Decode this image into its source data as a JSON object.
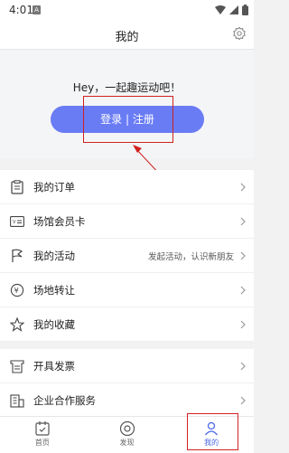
{
  "status_bar": {
    "time": "4:01",
    "sim_letter": "A"
  },
  "header": {
    "title": "我的"
  },
  "hero": {
    "greeting": "Hey，一起趣运动吧！",
    "login_label": "登录 | 注册"
  },
  "menu_group_1": [
    {
      "label": "我的订单",
      "sub": "",
      "icon": "clipboard-icon"
    },
    {
      "label": "场馆会员卡",
      "sub": "",
      "icon": "vip-card-icon"
    },
    {
      "label": "我的活动",
      "sub": "发起活动，认识新朋友",
      "icon": "flag-icon"
    },
    {
      "label": "场地转让",
      "sub": "",
      "icon": "transfer-icon"
    },
    {
      "label": "我的收藏",
      "sub": "",
      "icon": "star-icon"
    }
  ],
  "menu_group_2": [
    {
      "label": "开具发票",
      "sub": "",
      "icon": "invoice-icon"
    },
    {
      "label": "企业合作服务",
      "sub": "",
      "icon": "building-icon"
    }
  ],
  "tabbar": [
    {
      "label": "首页",
      "icon": "calendar-icon",
      "active": false
    },
    {
      "label": "发现",
      "icon": "discover-icon",
      "active": false
    },
    {
      "label": "我的",
      "icon": "person-icon",
      "active": true
    }
  ],
  "colors": {
    "accent": "#6a7cf4",
    "tab_active": "#4b67e8",
    "annotation": "#d12020"
  }
}
